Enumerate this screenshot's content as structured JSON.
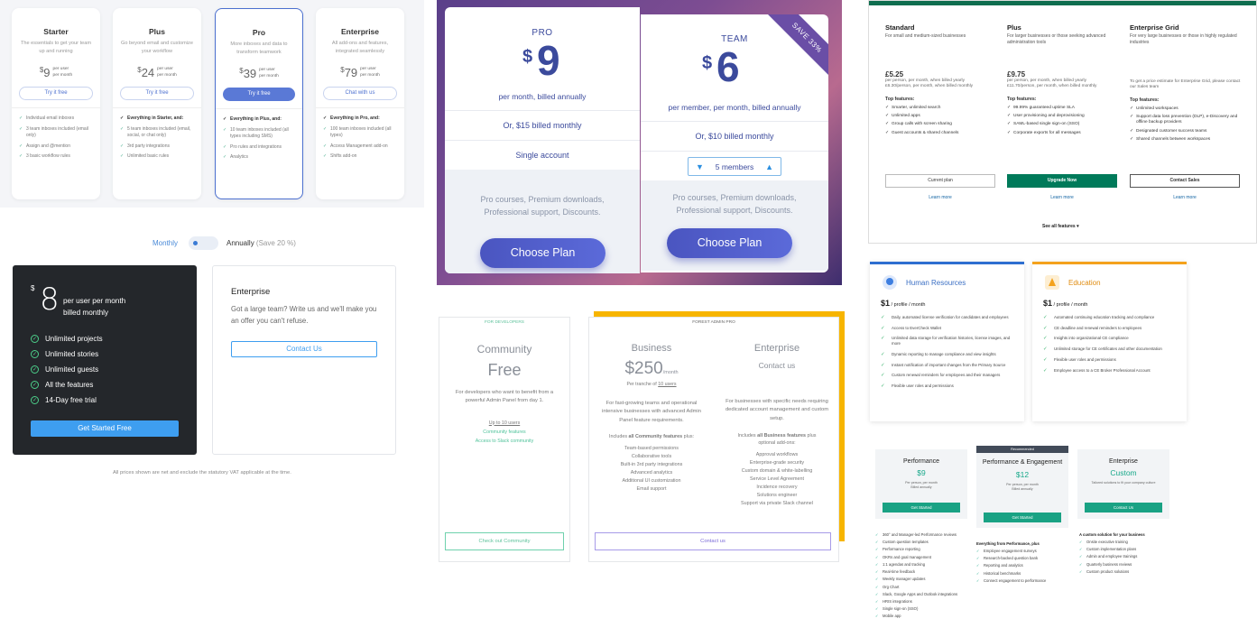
{
  "p1": {
    "cards": [
      {
        "name": "Starter",
        "desc": "The essentials to get your team up and running",
        "price": "9",
        "per": "per user\nper month",
        "btn": "Try it free",
        "features": [
          "Individual email inboxes",
          "3 team inboxes included (email only)",
          "Assign and @mention",
          "3 basic workflow rules"
        ],
        "header": ""
      },
      {
        "name": "Plus",
        "desc": "Go beyond email and customize your workflow",
        "price": "24",
        "per": "per user\nper month",
        "btn": "Try it free",
        "header": "Everything in Starter, and:",
        "features": [
          "5 team inboxes included (email, social, or chat only)",
          "3rd party integrations",
          "Unlimited basic rules"
        ]
      },
      {
        "name": "Pro",
        "desc": "More inboxes and data to transform teamwork",
        "price": "39",
        "per": "per user\nper month",
        "btn": "Try it free",
        "header": "Everything in Plus, and:",
        "features": [
          "10 team inboxes included (all types including SMS)",
          "Pro rules and integrations",
          "Analytics"
        ]
      },
      {
        "name": "Enterprise",
        "desc": "All add-ons and features, integrated seamlessly",
        "price": "79",
        "per": "per user\nper month",
        "btn": "Chat with us",
        "header": "Everything in Pro, and:",
        "features": [
          "100 team inboxes included (all types)",
          "Access Management add-on",
          "Shifts add-on"
        ]
      }
    ]
  },
  "p2": {
    "toggle_monthly": "Monthly",
    "toggle_annually": "Annually",
    "toggle_save": "(Save 20 %)",
    "dark": {
      "currency": "$",
      "price": "8",
      "per1": "per user per month",
      "per2": "billed monthly",
      "features": [
        "Unlimited projects",
        "Unlimited stories",
        "Unlimited guests",
        "All the features",
        "14-Day free trial"
      ],
      "btn": "Get Started Free"
    },
    "ent": {
      "title": "Enterprise",
      "desc": "Got a large team? Write us and we'll make you an offer you can't refuse.",
      "btn": "Contact Us"
    },
    "footnote": "All prices shown are net and exclude the statutory VAT applicable at the time."
  },
  "p3": {
    "pro": {
      "name": "PRO",
      "currency": "$",
      "price": "9",
      "billing": "per month, billed annually",
      "alt": "Or, $15 billed monthly",
      "seat": "Single account",
      "perks": "Pro courses, Premium downloads, Professional support, Discounts.",
      "btn": "Choose Plan"
    },
    "team": {
      "name": "TEAM",
      "currency": "$",
      "price": "6",
      "billing": "per member, per month, billed annually",
      "alt": "Or, $10 billed monthly",
      "members": "5 members",
      "perks": "Pro courses, Premium downloads, Professional support, Discounts.",
      "btn": "Choose Plan",
      "ribbon": "SAVE 33%"
    }
  },
  "p4": {
    "cols": [
      {
        "name": "Standard",
        "sub": "For small and medium-sized businesses",
        "price": "£5.25",
        "pd": "per person, per month, when billed yearly\n£6.30/person, per month, when billed monthly",
        "tf": "Top features:",
        "features": [
          "Smarter, unlimited search",
          "Unlimited apps",
          "Group calls with screen sharing",
          "Guest accounts & shared channels"
        ],
        "btn": "Current plan",
        "lm": "Learn more"
      },
      {
        "name": "Plus",
        "sub": "For larger businesses or those seeking advanced administration tools",
        "price": "£9.75",
        "pd": "per person, per month, when billed yearly\n£11.70/person, per month, when billed monthly",
        "tf": "Top features:",
        "features": [
          "99.99% guaranteed uptime SLA",
          "User provisioning and deprovisioning",
          "SAML-based single sign-on (SSO)",
          "Corporate exports for all messages"
        ],
        "btn": "Upgrade Now",
        "lm": "Learn more"
      },
      {
        "name": "Enterprise Grid",
        "sub": "For very large businesses or those in highly regulated industries",
        "price": "",
        "pd": "To get a price estimate for Enterprise Grid, please contact our Sales team",
        "tf": "Top features:",
        "features": [
          "Unlimited workspaces",
          "Support data loss prevention (DLP), e-Discovery and offline backup providers",
          "Designated customer success teams",
          "Shared channels between workspaces"
        ],
        "btn": "Contact Sales",
        "lm": "Learn more"
      }
    ],
    "see_all": "See all features ▾"
  },
  "p5": {
    "community": {
      "tag": "FOR DEVELOPERS",
      "title": "Community",
      "price": "Free",
      "desc": "For developers who want to benefit from a powerful Admin Panel from day 1.",
      "users": "Up to 10 users",
      "link1": "Community features",
      "link2": "Access to Slack community",
      "btn": "Check out Community"
    },
    "pro_tag": "FOREST ADMIN PRO",
    "business": {
      "title": "Business",
      "price": "$250",
      "month": "/month",
      "tranche": "Per tranche of ",
      "tranche_link": "10 users",
      "desc": "For fast-growing teams and operational intensive businesses with advanced Admin Panel feature requirements.",
      "inc_pre": "Includes ",
      "inc_bold": "all Community features",
      "inc_post": " plus:",
      "features": [
        "Team-based permissions",
        "Collaborative tools",
        "Built-in 3rd party integrations",
        "Advanced analytics",
        "Additional UI customization",
        "Email support"
      ]
    },
    "enterprise": {
      "title": "Enterprise",
      "sub": "Contact us",
      "desc": "For businesses with specific needs requiring dedicated account management and custom setup.",
      "inc_pre": "Includes ",
      "inc_bold": "all Business features",
      "inc_post": " plus optional add-ons:",
      "features": [
        "Approval workflows",
        "Enterprise-grade security",
        "Custom domain & white-labelling",
        "Service Level Agreement",
        "Incidence recovery",
        "Solutions engineer",
        "Support via private Slack channel"
      ]
    },
    "contact_btn": "Contact us"
  },
  "p6": {
    "hr": {
      "title": "Human Resources",
      "price": "$1",
      "unit": " / profile / month",
      "features": [
        "Daily, automated license verification for candidates and employees",
        "Access to EverCheck Wallet",
        "Unlimited data storage for verification histories, license images, and more",
        "Dynamic reporting to manage compliance and view insights",
        "Instant notification of important changes from the Primary Source",
        "Custom renewal reminders for employees and their managers",
        "Flexible user roles and permissions"
      ]
    },
    "edu": {
      "title": "Education",
      "price": "$1",
      "unit": " / profile / month",
      "features": [
        "Automated continuing education tracking and compliance",
        "CE deadline and renewal reminders to employees",
        "Insights into organizational CE compliance",
        "Unlimited storage for CE certificates and other documentation",
        "Flexible user roles and permissions",
        "Employee access to a CE Broker Professional Account"
      ]
    }
  },
  "p7": {
    "performance": {
      "title": "Performance",
      "price": "$9",
      "desc": "Per person, per month\nBilled annually",
      "btn": "Get Started",
      "features": [
        "360° and Manager-led Performance reviews",
        "Custom question templates",
        "Performance reporting",
        "OKRs and goal management",
        "1:1 agendas and tracking",
        "Real-time feedback",
        "Weekly manager updates",
        "Org Chart",
        "Slack, Google Apps and Outlook integrations",
        "HRIS integrations",
        "Single sign-on (SSO)",
        "Mobile app"
      ]
    },
    "engagement": {
      "badge": "Recommended",
      "title": "Performance & Engagement",
      "price": "$12",
      "desc": "Per person, per month\nBilled annually",
      "btn": "Get Started",
      "feat_head": "Everything from Performance, plus",
      "features": [
        "Employee engagement surveys",
        "Research-backed question bank",
        "Reporting and analytics",
        "Historical benchmarks",
        "Connect engagement to performance"
      ]
    },
    "enterprise": {
      "title": "Enterprise",
      "price": "Custom",
      "desc": "Tailored solutions to fit your company culture",
      "btn": "Contact Us",
      "feat_head": "A custom solution for your business",
      "features": [
        "Onsite executive training",
        "Custom implementation plans",
        "Admin and employee trainings",
        "Quarterly business reviews",
        "Custom product solutions"
      ]
    }
  }
}
